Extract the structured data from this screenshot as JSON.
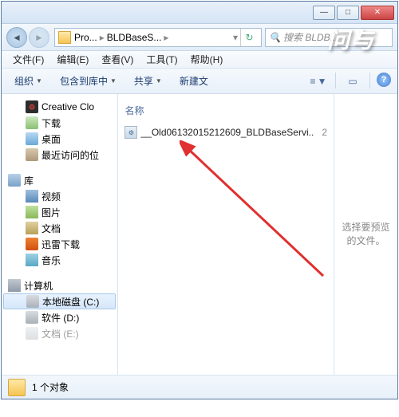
{
  "window": {
    "minimize": "—",
    "maximize": "□",
    "close": "✕"
  },
  "breadcrumb": {
    "item1": "Pro...",
    "item2": "BLDBaseS..."
  },
  "search": {
    "placeholder": "搜索 BLDB..."
  },
  "menu": {
    "file": "文件(F)",
    "edit": "编辑(E)",
    "view": "查看(V)",
    "tools": "工具(T)",
    "help": "帮助(H)"
  },
  "toolbar": {
    "organize": "组织",
    "addlib": "包含到库中",
    "share": "共享",
    "newfolder": "新建文"
  },
  "sidebar": {
    "creative": "Creative Clo",
    "downloads": "下载",
    "desktop": "桌面",
    "recent": "最近访问的位",
    "library": "库",
    "video": "视频",
    "pictures": "图片",
    "documents": "文档",
    "thunder": "迅雷下载",
    "music": "音乐",
    "computer": "计算机",
    "drivec": "本地磁盘 (C:)",
    "drived": "软件 (D:)",
    "drivee": "文档 (E:)"
  },
  "content": {
    "colname": "名称",
    "file1": "__Old06132015212609_BLDBaseServi..",
    "trail": "2"
  },
  "preview": {
    "text": "选择要预览的文件。"
  },
  "status": {
    "text": "1 个对象"
  },
  "watermark": "问与"
}
